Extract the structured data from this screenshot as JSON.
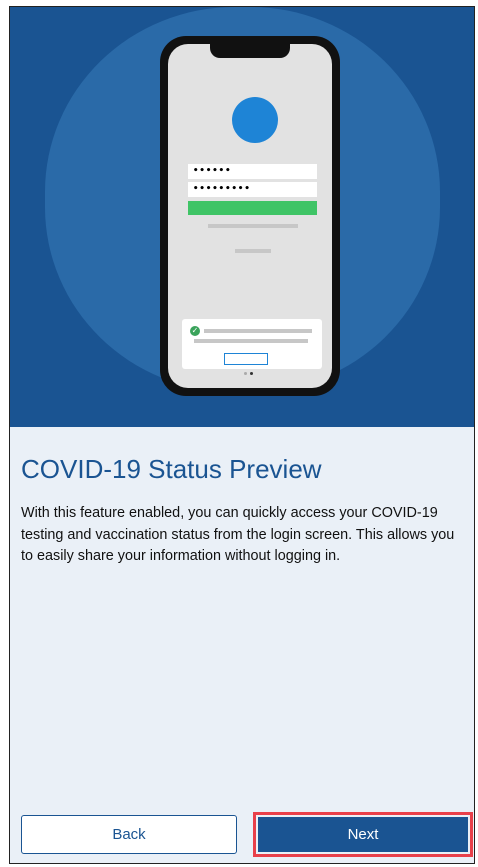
{
  "hero": {
    "illustration": "phone-login-illustration",
    "password_1": "••••••",
    "password_2": "•••••••••"
  },
  "content": {
    "title": "COVID-19 Status Preview",
    "description": "With this feature enabled, you can quickly access your COVID-19 testing and vaccination status from the login screen. This allows you to easily share your information without logging in."
  },
  "footer": {
    "back_label": "Back",
    "next_label": "Next"
  },
  "colors": {
    "brand_blue": "#1a5492",
    "highlight_red": "#e8404a",
    "success_green": "#3fc466"
  }
}
